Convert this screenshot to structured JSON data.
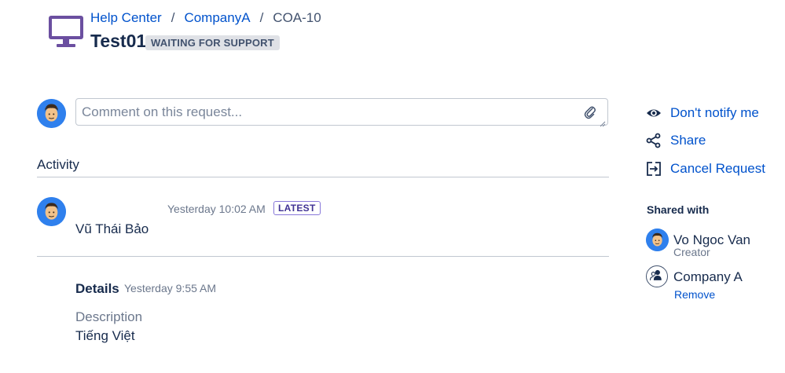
{
  "header": {
    "breadcrumb": [
      "Help Center",
      "CompanyA",
      "COA-10"
    ],
    "breadcrumb_separator": "/",
    "title": "Test01",
    "status": "WAITING FOR SUPPORT",
    "project_icon": "monitor-icon",
    "project_icon_color": "#6b4fa0"
  },
  "comment": {
    "placeholder": "Comment on this request...",
    "value": "",
    "attach_icon": "paperclip-icon"
  },
  "activity": {
    "heading": "Activity",
    "items": [
      {
        "author": "Vũ Thái Bảo",
        "timestamp": "Yesterday 10:02 AM",
        "badge": "LATEST"
      }
    ],
    "details": {
      "heading": "Details",
      "timestamp": "Yesterday 9:55 AM",
      "description_label": "Description",
      "description_value": "Tiếng Việt"
    }
  },
  "sidebar": {
    "actions": [
      {
        "label": "Don't notify me",
        "icon": "eye-icon"
      },
      {
        "label": "Share",
        "icon": "share-icon"
      },
      {
        "label": "Cancel Request",
        "icon": "exit-icon"
      }
    ],
    "shared_with": {
      "heading": "Shared with",
      "people": [
        {
          "name": "Vo Ngoc Van",
          "role": "Creator"
        }
      ],
      "organizations": [
        {
          "name": "Company A",
          "action": "Remove"
        }
      ]
    }
  },
  "colors": {
    "link": "#0052cc",
    "avatar_bg": "#2f80ed",
    "latest_border": "#8777d9",
    "status_bg": "#dfe1e6"
  }
}
